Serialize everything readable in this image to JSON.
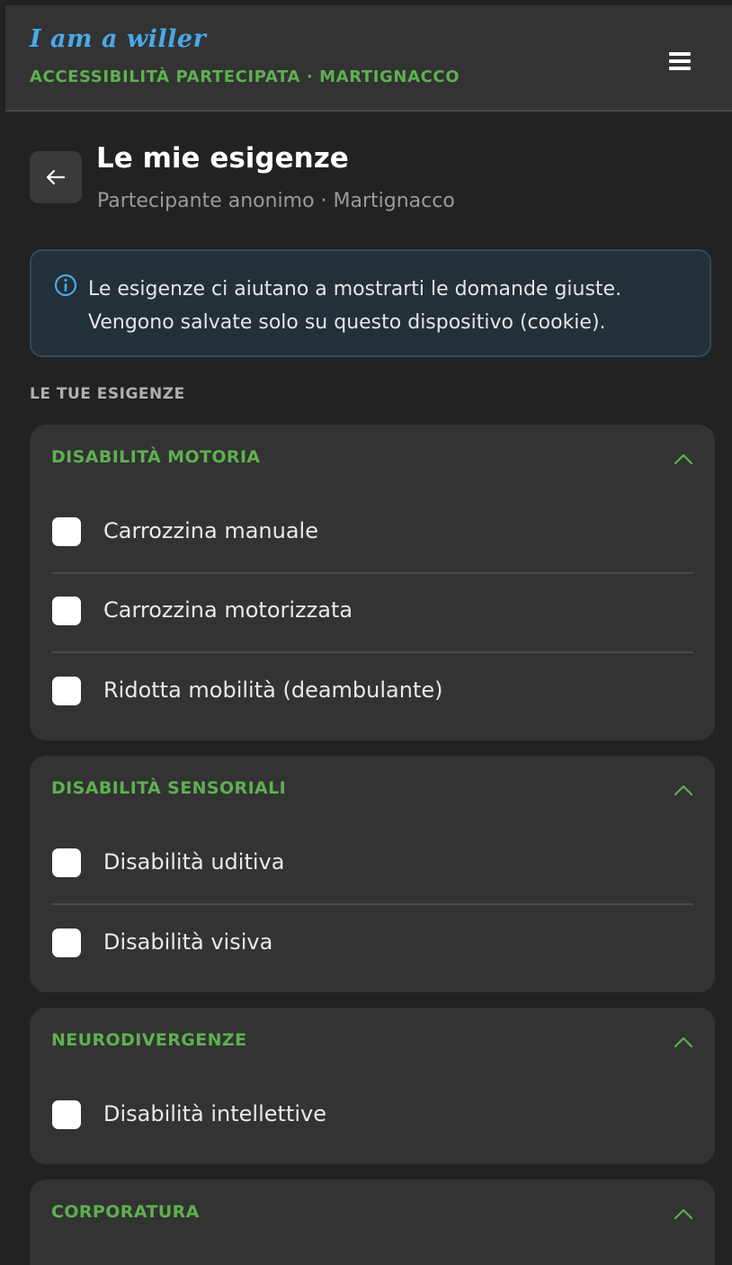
{
  "app": {
    "brand": "I am a willer",
    "subtitle": "ACCESSIBILITÀ PARTECIPATA · MARTIGNACCO"
  },
  "header": {
    "title": "Le mie esigenze",
    "subtitle": "Partecipante anonimo · Martignacco"
  },
  "info": {
    "line1": "Le esigenze ci aiutano a mostrarti le domande giuste.",
    "line2": "Vengono salvate solo su questo dispositivo (cookie)."
  },
  "section_label": "LE TUE ESIGENZE",
  "categories": [
    {
      "title": "DISABILITÀ MOTORIA",
      "expanded": true,
      "options": [
        {
          "label": "Carrozzina manuale",
          "checked": false
        },
        {
          "label": "Carrozzina motorizzata",
          "checked": false
        },
        {
          "label": "Ridotta mobilità (deambulante)",
          "checked": false
        }
      ]
    },
    {
      "title": "DISABILITÀ SENSORIALI",
      "expanded": true,
      "options": [
        {
          "label": "Disabilità uditiva",
          "checked": false
        },
        {
          "label": "Disabilità visiva",
          "checked": false
        }
      ]
    },
    {
      "title": "NEURODIVERGENZE",
      "expanded": true,
      "options": [
        {
          "label": "Disabilità intellettive",
          "checked": false
        }
      ]
    },
    {
      "title": "CORPORATURA",
      "expanded": true,
      "options": []
    }
  ],
  "icons": {
    "menu": "hamburger-menu-icon",
    "back": "arrow-left-icon",
    "info": "info-circle-icon",
    "collapse": "chevron-up-icon"
  },
  "colors": {
    "brand": "#4aa8e8",
    "accent": "#5db14f",
    "background": "#222222",
    "card": "#333333",
    "info_bg": "#233038",
    "info_border": "#2e4a5e"
  }
}
